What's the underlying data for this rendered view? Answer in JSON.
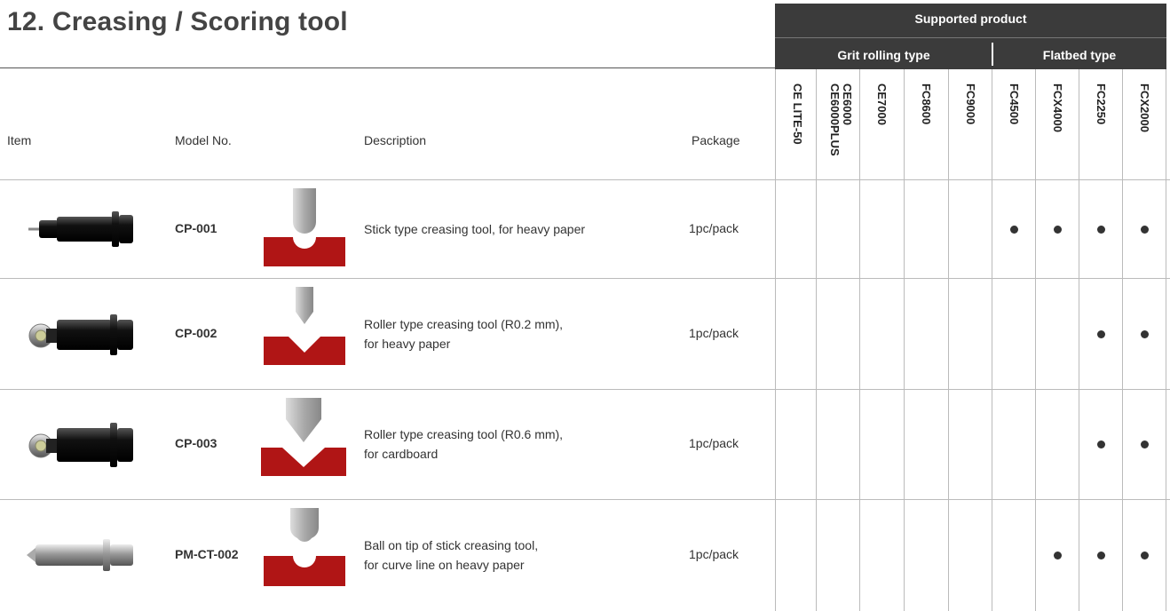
{
  "title": "12. Creasing / Scoring tool",
  "supported": {
    "title": "Supported product",
    "grit": "Grit rolling type",
    "flatbed": "Flatbed type"
  },
  "headers": {
    "item": "Item",
    "model": "Model No.",
    "description": "Description",
    "package": "Package"
  },
  "products": [
    "CE LITE-50",
    "CE6000\nCE6000PLUS",
    "CE7000",
    "FC8600",
    "FC9000",
    "FC4500",
    "FCX4000",
    "FC2250",
    "FCX2000"
  ],
  "rows": [
    {
      "model": "CP-001",
      "desc1": "Stick type creasing tool, for heavy paper",
      "desc2": "",
      "package": "1pc/pack",
      "supported": [
        false,
        false,
        false,
        false,
        false,
        true,
        true,
        true,
        true
      ]
    },
    {
      "model": "CP-002",
      "desc1": "Roller type creasing tool (R0.2 mm),",
      "desc2": "for heavy paper",
      "package": "1pc/pack",
      "supported": [
        false,
        false,
        false,
        false,
        false,
        false,
        false,
        true,
        true
      ]
    },
    {
      "model": "CP-003",
      "desc1": "Roller type creasing tool (R0.6 mm),",
      "desc2": "for cardboard",
      "package": "1pc/pack",
      "supported": [
        false,
        false,
        false,
        false,
        false,
        false,
        false,
        true,
        true
      ]
    },
    {
      "model": "PM-CT-002",
      "desc1": "Ball on tip of stick creasing tool,",
      "desc2": "for curve line on heavy paper",
      "package": "1pc/pack",
      "supported": [
        false,
        false,
        false,
        false,
        false,
        false,
        true,
        true,
        true
      ]
    }
  ],
  "colors": {
    "header_bg": "#3b3b3b",
    "diagram_red": "#b01515",
    "grid": "#bbbbbb"
  }
}
